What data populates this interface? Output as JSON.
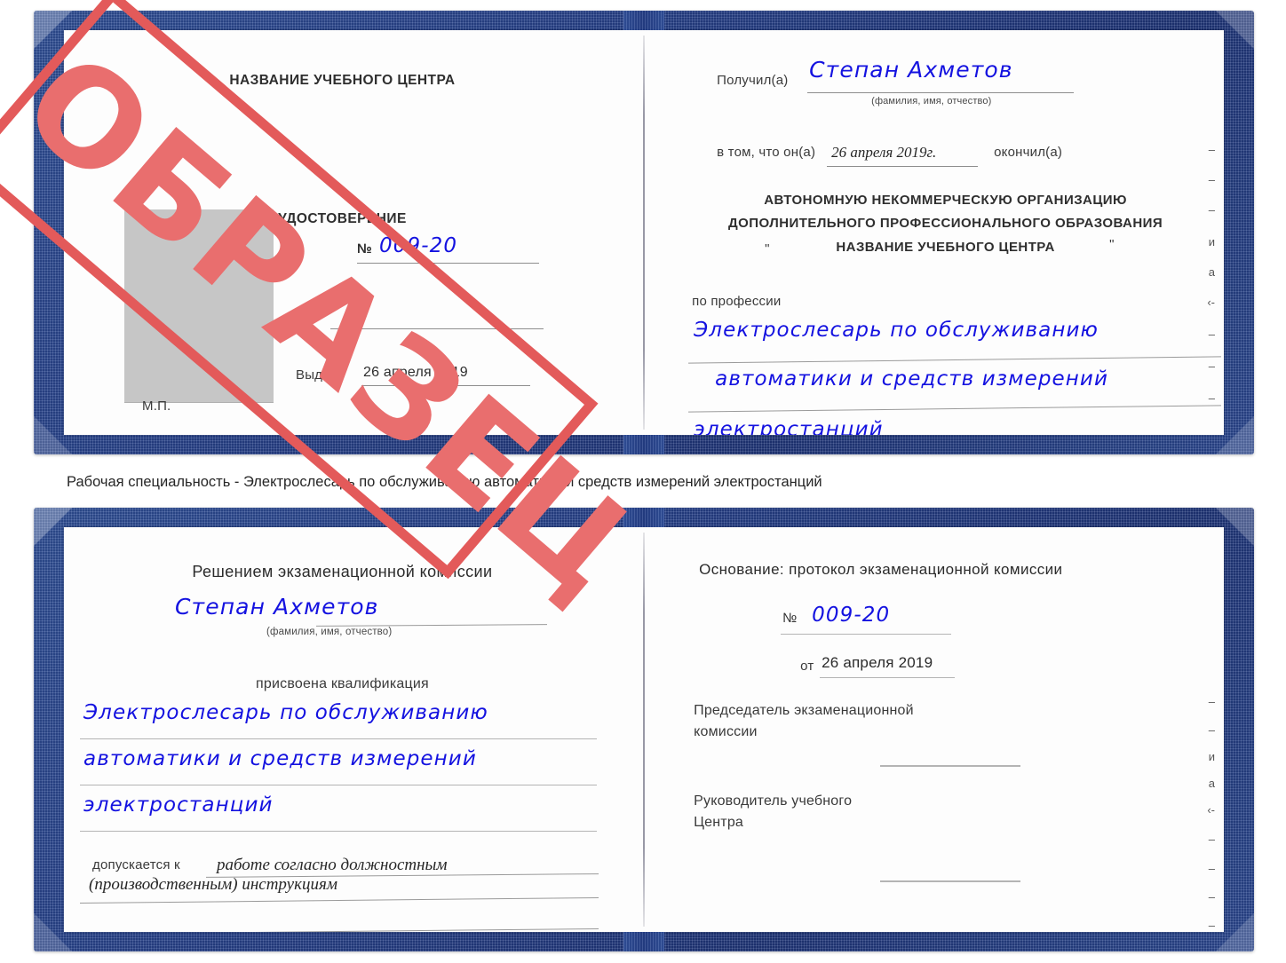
{
  "document": {
    "type_label": "УДОСТОВЕРЕНИЕ",
    "watermark": "ОБРАЗЕЦ",
    "caption": "Рабочая специальность - Электрослесарь по обслуживанию автоматики и средств измерений электростанций",
    "accent_cover_color": "#27418a",
    "watermark_color": "#e35a5a",
    "handwriting_color": "#1412e0"
  },
  "certificate_top": {
    "left_page": {
      "center_name": "НАЗВАНИЕ УЧЕБНОГО ЦЕНТРА",
      "doc_title": "УДОСТОВЕРЕНИЕ",
      "number_symbol": "№",
      "number_value": "009-20",
      "issued_label": "Выдано",
      "issued_date": "26 апреля 2019",
      "seal_label": "М.П."
    },
    "right_page": {
      "received_label": "Получил(а)",
      "received_name": "Степан Ахметов",
      "name_hint": "(фамилия, имя, отчество)",
      "in_that_label": "в том, что он(а)",
      "completion_date": "26 апреля 2019г.",
      "finished_label": "окончил(а)",
      "org_line1": "АВТОНОМНУЮ НЕКОММЕРЧЕСКУЮ ОРГАНИЗАЦИЮ",
      "org_line2": "ДОПОЛНИТЕЛЬНОГО ПРОФЕССИОНАЛЬНОГО ОБРАЗОВАНИЯ",
      "org_quote_open": "\"",
      "org_line3": "НАЗВАНИЕ УЧЕБНОГО ЦЕНТРА",
      "org_quote_close": "\"",
      "profession_label": "по профессии",
      "profession_line1": "Электрослесарь по обслуживанию",
      "profession_line2": "автоматики и средств измерений",
      "profession_line3": "электростанций"
    }
  },
  "certificate_bottom": {
    "left_page": {
      "decision_label": "Решением экзаменационной комиссии",
      "name": "Степан Ахметов",
      "name_hint": "(фамилия, имя, отчество)",
      "qualification_label": "присвоена квалификация",
      "qualification_line1": "Электрослесарь по обслуживанию",
      "qualification_line2": "автоматики и средств измерений",
      "qualification_line3": "электростанций",
      "admitted_label": "допускается к",
      "admitted_line1": "работе согласно должностным",
      "admitted_line2": "(производственным) инструкциям"
    },
    "right_page": {
      "basis_label": "Основание: протокол экзаменационной комиссии",
      "number_symbol": "№",
      "number_value": "009-20",
      "date_prefix": "от",
      "date_value": "26 апреля 2019",
      "chairman_line1": "Председатель экзаменационной",
      "chairman_line2": "комиссии",
      "head_line1": "Руководитель учебного",
      "head_line2": "Центра"
    }
  },
  "edge_artifacts": {
    "top": [
      "–",
      "–",
      "–",
      "и",
      "а",
      "‹-",
      "–",
      "–",
      "–",
      "–"
    ],
    "bottom": [
      "–",
      "–",
      "и",
      "а",
      "‹-",
      "–",
      "–",
      "–",
      "–"
    ]
  }
}
